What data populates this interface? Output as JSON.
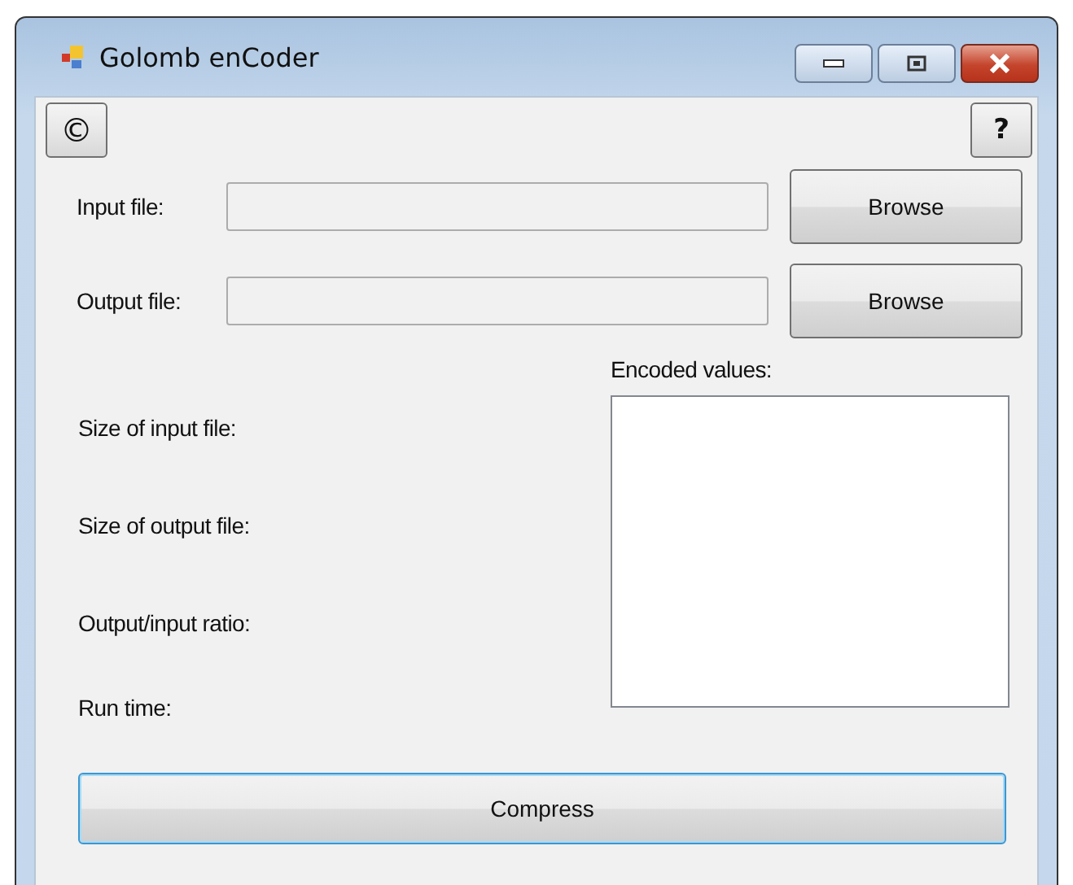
{
  "window": {
    "title": "Golomb enCoder"
  },
  "toolbar": {
    "left_button": "©",
    "right_button": "?"
  },
  "file_rows": [
    {
      "label": "Input file:",
      "button": "Browse"
    },
    {
      "label": "Output file:",
      "button": "Browse"
    }
  ],
  "encoded_values": {
    "label": "Encoded values:"
  },
  "stats": [
    "Size of input file:",
    "Size of output file:",
    "Output/input ratio:",
    "Run time:"
  ],
  "compress_button": {
    "label": "Compress",
    "focused": true
  }
}
